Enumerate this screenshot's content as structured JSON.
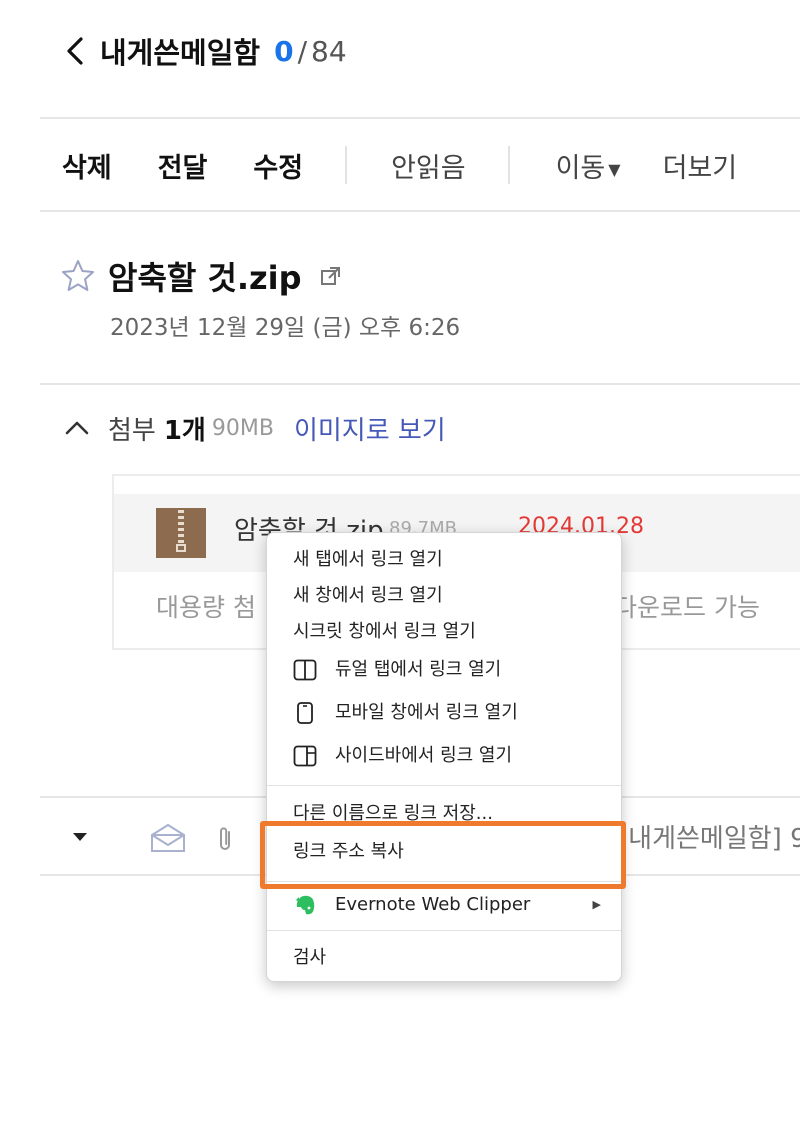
{
  "header": {
    "title": "내게쓴메일함",
    "count_current": "0",
    "count_separator": "/",
    "count_total": "84"
  },
  "toolbar": {
    "delete": "삭제",
    "forward": "전달",
    "edit": "수정",
    "unread": "안읽음",
    "move": "이동",
    "more": "더보기"
  },
  "mail": {
    "subject": "암축할 것.zip",
    "date": "2023년 12월 29일 (금) 오후 6:26"
  },
  "attachment": {
    "label": "첨부",
    "count": "1개",
    "size": "90MB",
    "view_as_image": "이미지로 보기",
    "file_name": "암축할 것.zip",
    "file_size": "89.7MB",
    "expire_date": "2024.01.28",
    "note_left": "대용량 첨",
    "note_right": "다운로드 가능"
  },
  "bottom_row": {
    "subject_partial": "[내게쓴메일함] 9"
  },
  "context_menu": {
    "new_tab": "새 탭에서 링크 열기",
    "new_window": "새 창에서 링크 열기",
    "secret_window": "시크릿 창에서 링크 열기",
    "dual_tab": "듀얼 탭에서 링크 열기",
    "mobile_window": "모바일 창에서 링크 열기",
    "sidebar": "사이드바에서 링크 열기",
    "save_link_as": "다른 이름으로 링크 저장...",
    "copy_link": "링크 주소 복사",
    "evernote": "Evernote Web Clipper",
    "inspect": "검사"
  },
  "colors": {
    "accent_blue": "#1a73e8",
    "link_blue": "#4659b8",
    "date_red": "#e53935",
    "highlight_orange": "#ef7a2d",
    "zip_brown": "#8c6b4f",
    "evernote_green": "#2dbe60"
  }
}
